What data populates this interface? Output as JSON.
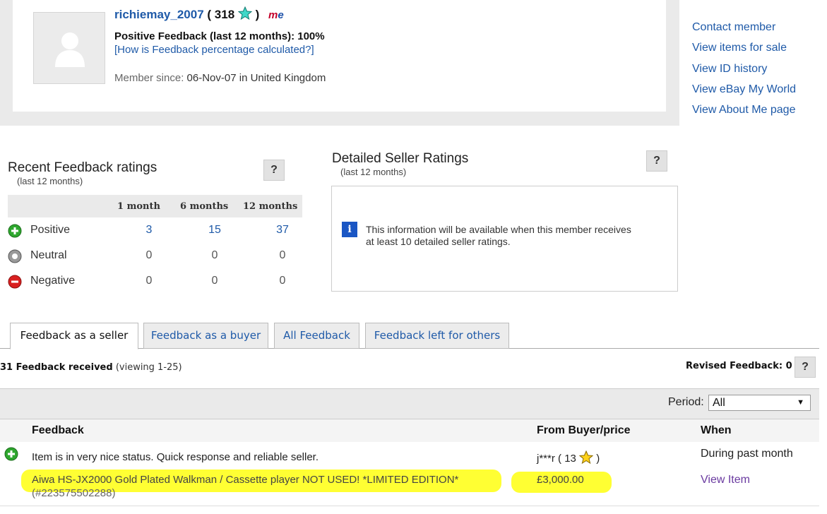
{
  "profile": {
    "username": "richiemay_2007",
    "score_open": "(",
    "score": "318",
    "score_close": ")",
    "me_badge_m": "m",
    "me_badge_e": "e",
    "positive_feedback": "Positive Feedback (last 12 months): 100%",
    "how_link": "[How is Feedback percentage calculated?]",
    "member_since_label": "Member since:",
    "member_since_value": "06-Nov-07 in United Kingdom"
  },
  "side_links": [
    "Contact member",
    "View items for sale",
    "View ID history",
    "View eBay My World",
    "View About Me page"
  ],
  "recent": {
    "title": "Recent Feedback ratings",
    "subtitle": "(last 12 months)",
    "help": "?",
    "headers": [
      "1 month",
      "6 months",
      "12 months"
    ],
    "rows": [
      {
        "label": "Positive",
        "values": [
          "3",
          "15",
          "37"
        ]
      },
      {
        "label": "Neutral",
        "values": [
          "0",
          "0",
          "0"
        ]
      },
      {
        "label": "Negative",
        "values": [
          "0",
          "0",
          "0"
        ]
      }
    ]
  },
  "dsr": {
    "title": "Detailed Seller Ratings",
    "subtitle": "(last 12 months)",
    "help": "?",
    "info_icon": "i",
    "message": "This information will be available when this member receives at least 10 detailed seller ratings."
  },
  "tabs": [
    "Feedback as a seller",
    "Feedback as a buyer",
    "All Feedback",
    "Feedback left for others"
  ],
  "received": {
    "count_text": "31 Feedback received",
    "viewing": "(viewing 1-25)",
    "revised": "Revised Feedback: 0",
    "help": "?"
  },
  "period": {
    "label": "Period:",
    "value": "All",
    "arrow": "▼"
  },
  "table": {
    "headers": {
      "feedback": "Feedback",
      "from": "From Buyer/price",
      "when": "When"
    },
    "row": {
      "comment": "Item is in very nice status. Quick response and reliable seller.",
      "buyer": "j***r",
      "buyer_score_open": "(",
      "buyer_score": "13",
      "buyer_score_close": ")",
      "when": "During past month",
      "item": "Aiwa HS-JX2000 Gold Plated Walkman / Cassette player NOT USED! *LIMITED EDITION*",
      "item_id": "(#223575502288)",
      "price": "£3,000.00",
      "view_item": "View Item"
    }
  },
  "colors": {
    "positive": "#2ea72e",
    "neutral": "#8a8a8a",
    "negative": "#d92020",
    "highlight": "#ffff33",
    "link": "#1f5aa8"
  }
}
